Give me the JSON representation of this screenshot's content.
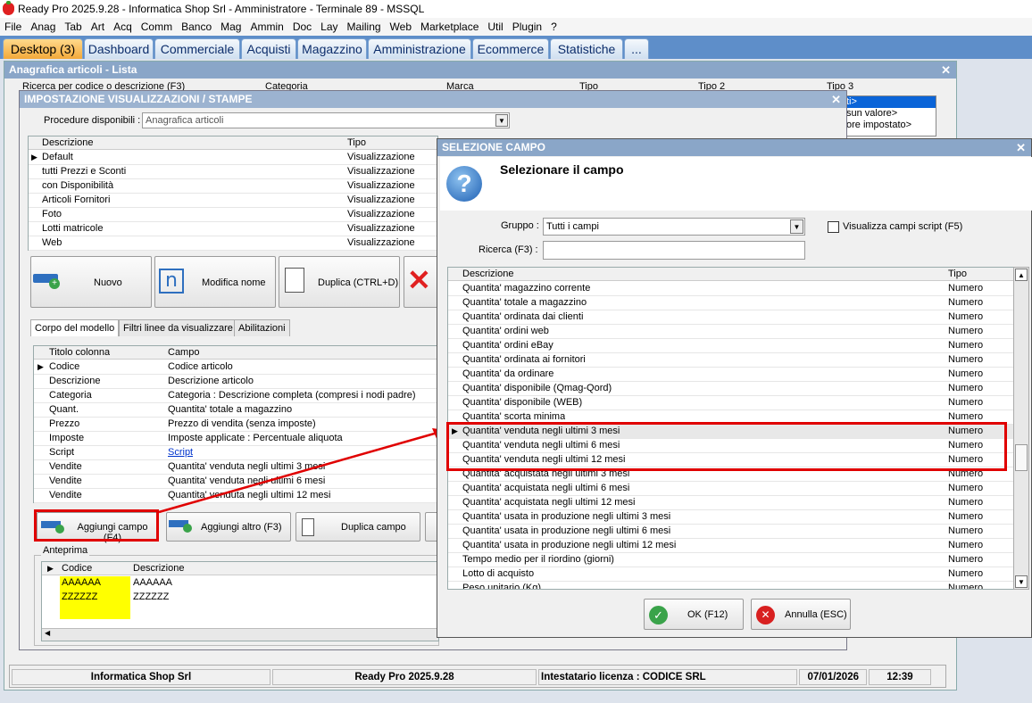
{
  "app_title": "Ready Pro 2025.9.28 - Informatica Shop Srl - Amministratore - Terminale 89 - MSSQL",
  "menu": [
    "File",
    "Anag",
    "Tab",
    "Art",
    "Acq",
    "Comm",
    "Banco",
    "Mag",
    "Ammin",
    "Doc",
    "Lay",
    "Mailing",
    "Web",
    "Marketplace",
    "Util",
    "Plugin",
    "?"
  ],
  "tabs": [
    "Desktop (3)",
    "Dashboard",
    "Commerciale",
    "Acquisti",
    "Magazzino",
    "Amministrazione",
    "Ecommerce",
    "Statistiche",
    "..."
  ],
  "main_window": {
    "title": "Anagrafica articoli  - Lista",
    "filter_labels": [
      "Ricerca per codice o descrizione (F3)",
      "Categoria",
      "Marca",
      "Tipo",
      "Tipo 2",
      "Tipo 3"
    ],
    "dropdown_items": [
      "ti>",
      "sun valore>",
      "ore impostato>"
    ]
  },
  "impostazione": {
    "title": "IMPOSTAZIONE VISUALIZZAZIONI / STAMPE",
    "procedure_label": "Procedure disponibili :",
    "procedure_value": "Anagrafica articoli",
    "grid_headers": [
      "Descrizione",
      "Tipo"
    ],
    "grid_rows": [
      [
        "Default",
        "Visualizzazione"
      ],
      [
        "tutti Prezzi e Sconti",
        "Visualizzazione"
      ],
      [
        "con Disponibilità",
        "Visualizzazione"
      ],
      [
        "Articoli Fornitori",
        "Visualizzazione"
      ],
      [
        "Foto",
        "Visualizzazione"
      ],
      [
        "Lotti matricole",
        "Visualizzazione"
      ],
      [
        "Web",
        "Visualizzazione"
      ]
    ],
    "buttons": {
      "nuovo": "Nuovo",
      "modifica": "Modifica nome",
      "duplica": "Duplica (CTRL+D)"
    },
    "subtabs": [
      "Corpo del modello",
      "Filtri linee da visualizzare",
      "Abilitazioni"
    ],
    "col_headers": [
      "Titolo colonna",
      "Campo"
    ],
    "col_rows": [
      [
        "Codice",
        "Codice articolo"
      ],
      [
        "Descrizione",
        "Descrizione articolo"
      ],
      [
        "Categoria",
        "Categoria : Descrizione completa (compresi i nodi padre)"
      ],
      [
        "Quant.",
        "Quantita' totale a magazzino"
      ],
      [
        "Prezzo",
        "Prezzo di vendita (senza imposte)"
      ],
      [
        "Imposte",
        "Imposte applicate : Percentuale aliquota"
      ],
      [
        "Script",
        "Script"
      ],
      [
        "Vendite",
        "Quantita' venduta negli ultimi 3 mesi"
      ],
      [
        "Vendite",
        "Quantita' venduta negli ultimi 6 mesi"
      ],
      [
        "Vendite",
        "Quantita' venduta negli ultimi 12 mesi"
      ]
    ],
    "bottom_buttons": {
      "aggiungi": "Aggiungi campo (F4)",
      "aggiungi_altro": "Aggiungi altro (F3)",
      "duplica_campo": "Duplica campo"
    },
    "anteprima_label": "Anteprima",
    "anteprima_headers": [
      "Codice",
      "Descrizione"
    ],
    "anteprima_rows": [
      [
        "AAAAAA",
        "AAAAAA"
      ],
      [
        "ZZZZZZ",
        "ZZZZZZ"
      ]
    ]
  },
  "selezione": {
    "title": "SELEZIONE CAMPO",
    "heading": "Selezionare il campo",
    "gruppo_label": "Gruppo :",
    "gruppo_value": "Tutti i campi",
    "checkbox_label": "Visualizza campi script (F5)",
    "ricerca_label": "Ricerca (F3) :",
    "ricerca_value": "",
    "headers": [
      "Descrizione",
      "Tipo"
    ],
    "rows": [
      [
        "Quantita' magazzino corrente",
        "Numero"
      ],
      [
        "Quantita' totale a magazzino",
        "Numero"
      ],
      [
        "Quantita' ordinata dai clienti",
        "Numero"
      ],
      [
        "Quantita' ordini web",
        "Numero"
      ],
      [
        "Quantita' ordini eBay",
        "Numero"
      ],
      [
        "Quantita' ordinata ai fornitori",
        "Numero"
      ],
      [
        "Quantita' da ordinare",
        "Numero"
      ],
      [
        "Quantita' disponibile (Qmag-Qord)",
        "Numero"
      ],
      [
        "Quantita' disponibile (WEB)",
        "Numero"
      ],
      [
        "Quantita' scorta minima",
        "Numero"
      ],
      [
        "Quantita' venduta negli ultimi 3 mesi",
        "Numero"
      ],
      [
        "Quantita' venduta negli ultimi 6 mesi",
        "Numero"
      ],
      [
        "Quantita' venduta negli ultimi 12 mesi",
        "Numero"
      ],
      [
        "Quantita' acquistata negli ultimi 3 mesi",
        "Numero"
      ],
      [
        "Quantita' acquistata negli ultimi 6 mesi",
        "Numero"
      ],
      [
        "Quantita' acquistata negli ultimi 12 mesi",
        "Numero"
      ],
      [
        "Quantita' usata in produzione negli ultimi 3 mesi",
        "Numero"
      ],
      [
        "Quantita' usata in produzione negli ultimi 6 mesi",
        "Numero"
      ],
      [
        "Quantita' usata in produzione negli ultimi 12 mesi",
        "Numero"
      ],
      [
        "Tempo medio per il riordino (giorni)",
        "Numero"
      ],
      [
        "Lotto di acquisto",
        "Numero"
      ],
      [
        "Peso unitario (Kg)",
        "Numero"
      ]
    ],
    "ok_label": "OK (F12)",
    "annulla_label": "Annulla (ESC)"
  },
  "status": {
    "company": "Informatica Shop Srl",
    "version": "Ready Pro 2025.9.28",
    "licensee": "Intestatario licenza : CODICE SRL",
    "date": "07/01/2026",
    "time": "12:39"
  },
  "colors": {
    "accent": "#5e8ec9",
    "active_tab": "#f3a93a",
    "highlight": "#e00000",
    "preview_yellow": "#ffff00"
  }
}
